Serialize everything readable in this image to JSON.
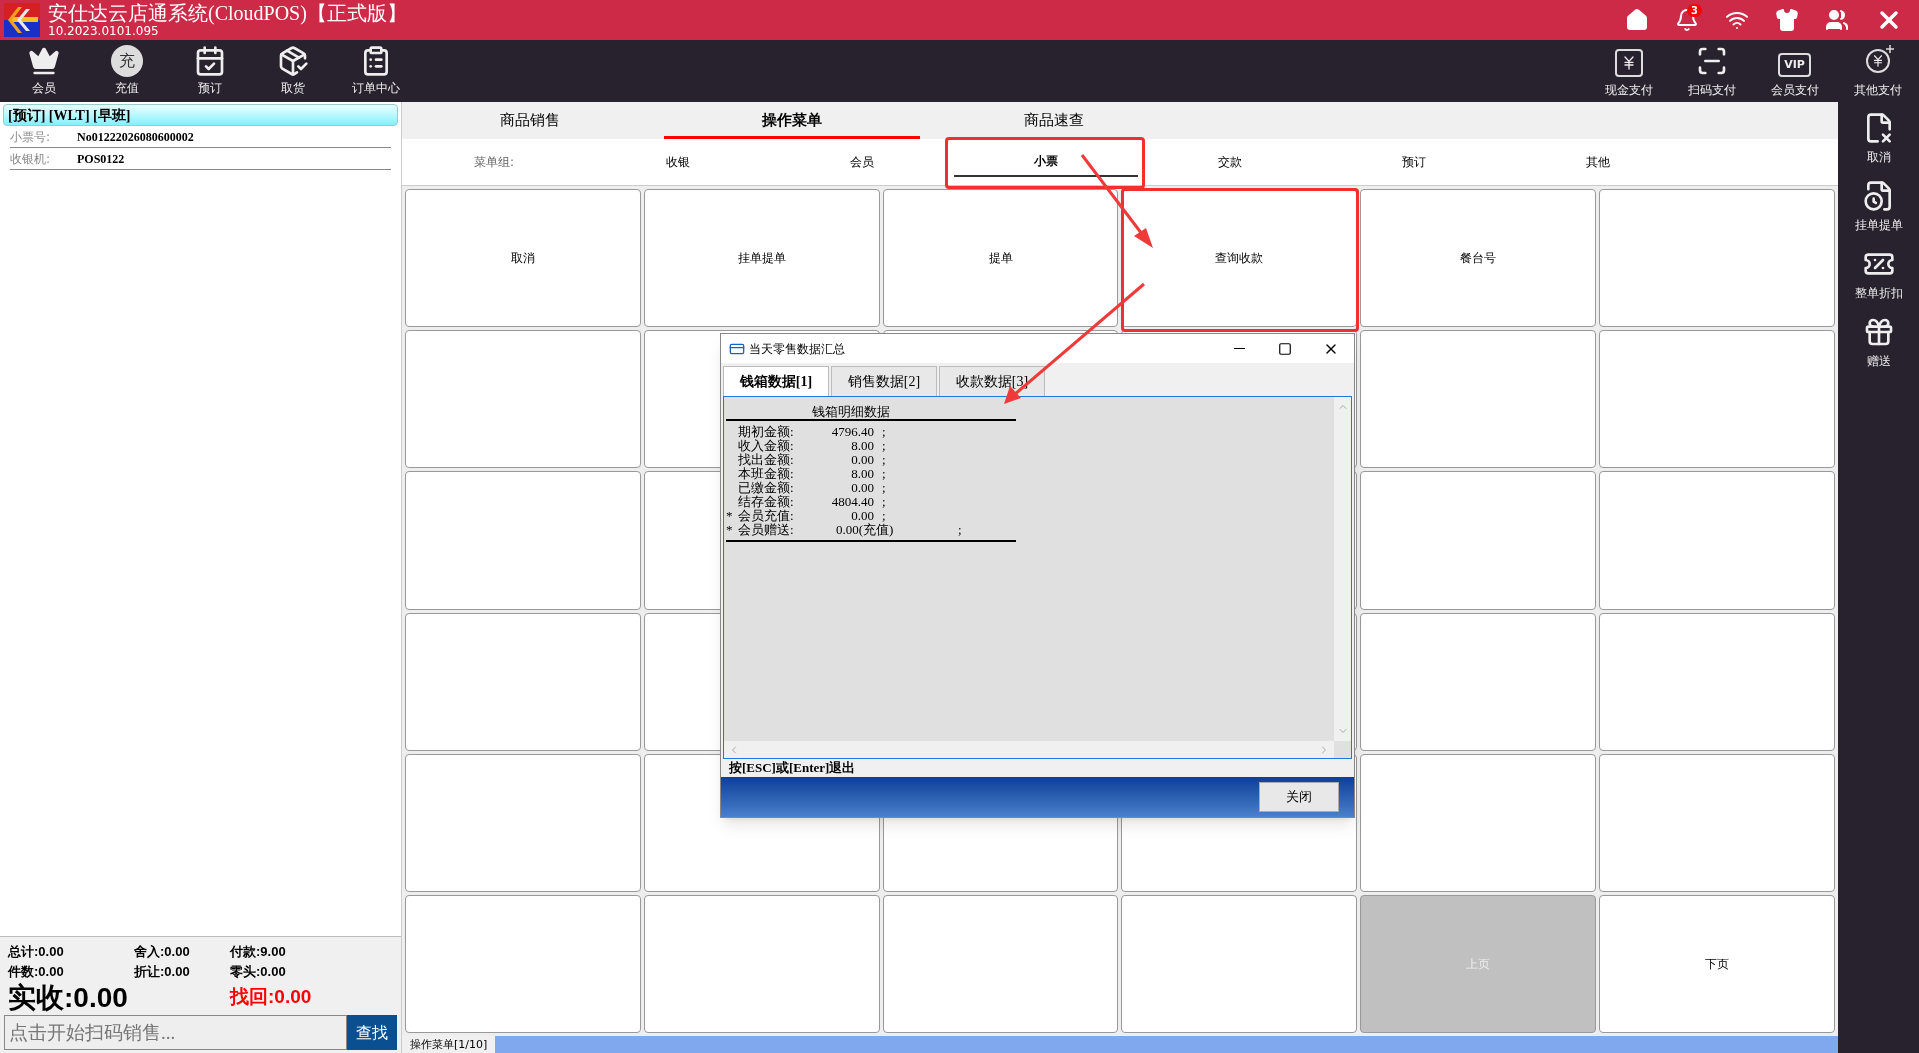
{
  "window": {
    "title": "安仕达云店通系统(CloudPOS)【正式版】",
    "version": "10.2023.0101.095",
    "notification_count": "3"
  },
  "toolbar_left": [
    {
      "kind": "crown",
      "label": "会员"
    },
    {
      "kind": "charge",
      "label": "充值",
      "glyph": "充"
    },
    {
      "kind": "calendar",
      "label": "预订"
    },
    {
      "kind": "package",
      "label": "取货"
    },
    {
      "kind": "clipboard",
      "label": "订单中心"
    }
  ],
  "toolbar_right": [
    {
      "kind": "yen",
      "label": "现金支付"
    },
    {
      "kind": "scan",
      "label": "扫码支付"
    },
    {
      "kind": "vip",
      "label": "会员支付",
      "glyph": "VIP"
    },
    {
      "kind": "yen-plus",
      "label": "其他支付"
    }
  ],
  "order_panel": {
    "header": "[预订] [WLT] [早班]",
    "fields": [
      {
        "label": "小票号:",
        "value": "No01222026080600002"
      },
      {
        "label": "收银机:",
        "value": "POS0122"
      }
    ]
  },
  "summary": {
    "items": [
      {
        "text": "总计:0.00"
      },
      {
        "text": "舍入:0.00"
      },
      {
        "text": "付款:9.00"
      },
      {
        "text": "件数:0.00"
      },
      {
        "text": "折让:0.00"
      },
      {
        "text": "零头:0.00"
      }
    ],
    "received": "实收:0.00",
    "change": "找回:0.00"
  },
  "scan": {
    "placeholder": "点击开始扫码销售...",
    "button": "查找"
  },
  "tabs": [
    {
      "label": "商品销售",
      "selected": false
    },
    {
      "label": "操作菜单",
      "selected": true
    },
    {
      "label": "商品速查",
      "selected": false
    }
  ],
  "menu_groups": {
    "label": "菜单组:",
    "items": [
      {
        "label": "收银",
        "selected": false
      },
      {
        "label": "会员",
        "selected": false
      },
      {
        "label": "小票",
        "selected": true
      },
      {
        "label": "交款",
        "selected": false
      },
      {
        "label": "预订",
        "selected": false
      },
      {
        "label": "其他",
        "selected": false
      }
    ]
  },
  "grid_cells": [
    {
      "label": "取消",
      "disabled": false
    },
    {
      "label": "挂单提单",
      "disabled": false
    },
    {
      "label": "提单",
      "disabled": false
    },
    {
      "label": "查询收款",
      "disabled": false
    },
    {
      "label": "餐台号",
      "disabled": false
    },
    {
      "disabled": false
    },
    {
      "disabled": false
    },
    {
      "disabled": false
    },
    {
      "disabled": false
    },
    {
      "disabled": false
    },
    {
      "disabled": false
    },
    {
      "disabled": false
    },
    {
      "disabled": false
    },
    {
      "disabled": false
    },
    {},
    {
      "disabled": false
    },
    {
      "disabled": false
    },
    {
      "disabled": false
    },
    {
      "disabled": false
    },
    {
      "disabled": false
    },
    {},
    {
      "disabled": false
    },
    {
      "disabled": false
    },
    {
      "disabled": false
    },
    {
      "disabled": false
    },
    {
      "disabled": false
    },
    {
      "disabled": false
    },
    {
      "disabled": false
    },
    {
      "disabled": false
    },
    {
      "disabled": false
    },
    {
      "disabled": false
    },
    {
      "disabled": false
    },
    {
      "disabled": false
    },
    {
      "disabled": false
    },
    {
      "label": "上页",
      "disabled": true
    },
    {
      "label": "下页",
      "disabled": false
    }
  ],
  "page_indicator": "操作菜单[1/10]",
  "sidebar": [
    {
      "kind": "cancel",
      "label": "取消"
    },
    {
      "kind": "hold",
      "label": "挂单提单"
    },
    {
      "kind": "discount",
      "label": "整单折扣"
    },
    {
      "kind": "gift",
      "label": "赠送"
    }
  ],
  "dialog": {
    "title": "当天零售数据汇总",
    "tabs": [
      {
        "label": "钱箱数据[1]",
        "selected": true
      },
      {
        "label": "销售数据[2]",
        "selected": false
      },
      {
        "label": "收款数据[3]",
        "selected": false
      }
    ],
    "heading": "钱箱明细数据",
    "rows": [
      {
        "label": "期初金额:",
        "value": "4796.40",
        "end": ";"
      },
      {
        "label": "收入金额:",
        "value": "8.00",
        "end": ";"
      },
      {
        "label": "找出金额:",
        "value": "0.00",
        "end": ";"
      },
      {
        "label": "本班金额:",
        "value": "8.00",
        "end": ";"
      },
      {
        "label": "已缴金额:",
        "value": "0.00",
        "end": ";"
      },
      {
        "label": "结存金额:",
        "value": "4804.40",
        "end": ";"
      },
      {
        "mark": "*",
        "label": "会员充值:",
        "value": "0.00",
        "end": ";"
      },
      {
        "mark": "*",
        "label": "会员赠送:",
        "value": "0.00(充值)",
        "end": ";"
      }
    ],
    "hint": "按[ESC]或[Enter]退出",
    "close_button": "关闭"
  }
}
